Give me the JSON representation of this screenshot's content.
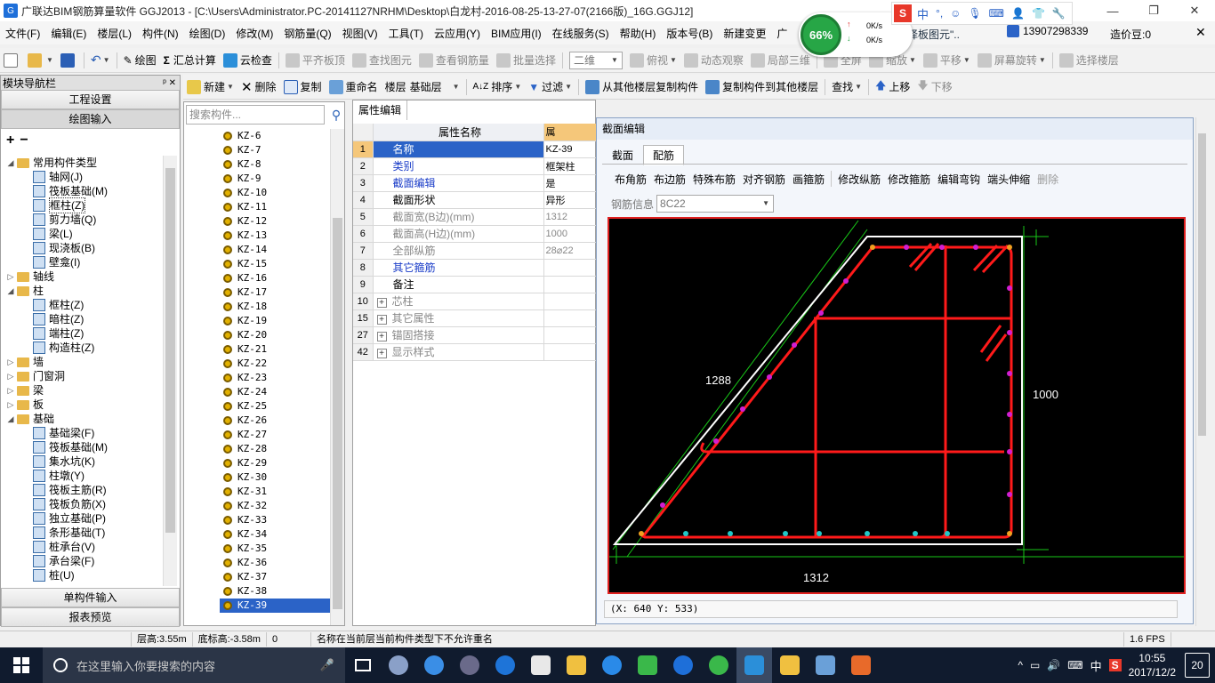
{
  "window": {
    "title": "广联达BIM钢筋算量软件 GGJ2013 - [C:\\Users\\Administrator.PC-20141127NRHM\\Desktop\\白龙村-2016-08-25-13-27-07(2166版)_16G.GGJ12]"
  },
  "menu": [
    "文件(F)",
    "编辑(E)",
    "楼层(L)",
    "构件(N)",
    "绘图(D)",
    "修改(M)",
    "钢筋量(Q)",
    "视图(V)",
    "工具(T)",
    "云应用(Y)",
    "BIM应用(I)",
    "在线服务(S)",
    "帮助(H)",
    "版本号(B)",
    "新建变更",
    "广"
  ],
  "menu_right": {
    "select_hint": "选择板图元\"..",
    "phone": "13907298339",
    "price": "造价豆:0"
  },
  "toolbar1": {
    "draw": "绘图",
    "sum": "汇总计算",
    "cloud_check": "云检查",
    "flat_top": "平齐板顶",
    "find_element": "查找图元",
    "view_rebar": "查看钢筋量",
    "batch_select": "批量选择",
    "view_mode": "二维",
    "top_view": "俯视",
    "dynamic": "动态观察",
    "local_3d": "局部三维",
    "full_screen": "全屏",
    "zoom": "缩放",
    "pan": "平移",
    "rotate": "屏幕旋转",
    "select_floor": "选择楼层"
  },
  "toolbar2": {
    "new": "新建",
    "delete": "删除",
    "copy": "复制",
    "rename": "重命名",
    "floor_label": "楼层",
    "floor_value": "基础层",
    "sort": "排序",
    "filter": "过滤",
    "copy_from": "从其他楼层复制构件",
    "copy_to": "复制构件到其他楼层",
    "find": "查找",
    "up": "上移",
    "down": "下移"
  },
  "leftnav": {
    "header": "模块导航栏",
    "project_settings": "工程设置",
    "drawing_input": "绘图输入",
    "single_input": "单构件输入",
    "report_preview": "报表预览",
    "tree": [
      {
        "level": 0,
        "exp": "−",
        "type": "folder",
        "label": "常用构件类型"
      },
      {
        "level": 1,
        "type": "comp",
        "label": "轴网(J)"
      },
      {
        "level": 1,
        "type": "comp",
        "label": "筏板基础(M)"
      },
      {
        "level": 1,
        "type": "comp",
        "label": "框柱(Z)"
      },
      {
        "level": 1,
        "type": "comp",
        "label": "剪力墙(Q)"
      },
      {
        "level": 1,
        "type": "comp",
        "label": "梁(L)"
      },
      {
        "level": 1,
        "type": "comp",
        "label": "现浇板(B)"
      },
      {
        "level": 1,
        "type": "comp",
        "label": "壁龛(I)"
      },
      {
        "level": 0,
        "exp": "+",
        "type": "folder",
        "label": "轴线"
      },
      {
        "level": 0,
        "exp": "−",
        "type": "folder",
        "label": "柱"
      },
      {
        "level": 1,
        "type": "comp",
        "label": "框柱(Z)"
      },
      {
        "level": 1,
        "type": "comp",
        "label": "暗柱(Z)"
      },
      {
        "level": 1,
        "type": "comp",
        "label": "端柱(Z)"
      },
      {
        "level": 1,
        "type": "comp",
        "label": "构造柱(Z)"
      },
      {
        "level": 0,
        "exp": "+",
        "type": "folder",
        "label": "墙"
      },
      {
        "level": 0,
        "exp": "+",
        "type": "folder",
        "label": "门窗洞"
      },
      {
        "level": 0,
        "exp": "+",
        "type": "folder",
        "label": "梁"
      },
      {
        "level": 0,
        "exp": "+",
        "type": "folder",
        "label": "板"
      },
      {
        "level": 0,
        "exp": "−",
        "type": "folder",
        "label": "基础"
      },
      {
        "level": 1,
        "type": "comp",
        "label": "基础梁(F)"
      },
      {
        "level": 1,
        "type": "comp",
        "label": "筏板基础(M)"
      },
      {
        "level": 1,
        "type": "comp",
        "label": "集水坑(K)"
      },
      {
        "level": 1,
        "type": "comp",
        "label": "柱墩(Y)"
      },
      {
        "level": 1,
        "type": "comp",
        "label": "筏板主筋(R)"
      },
      {
        "level": 1,
        "type": "comp",
        "label": "筏板负筋(X)"
      },
      {
        "level": 1,
        "type": "comp",
        "label": "独立基础(P)"
      },
      {
        "level": 1,
        "type": "comp",
        "label": "条形基础(T)"
      },
      {
        "level": 1,
        "type": "comp",
        "label": "桩承台(V)"
      },
      {
        "level": 1,
        "type": "comp",
        "label": "承台梁(F)"
      },
      {
        "level": 1,
        "type": "comp",
        "label": "桩(U)"
      }
    ]
  },
  "complist": {
    "search_placeholder": "搜索构件...",
    "items": [
      "KZ-6",
      "KZ-7",
      "KZ-8",
      "KZ-9",
      "KZ-10",
      "KZ-11",
      "KZ-12",
      "KZ-13",
      "KZ-14",
      "KZ-15",
      "KZ-16",
      "KZ-17",
      "KZ-18",
      "KZ-19",
      "KZ-20",
      "KZ-21",
      "KZ-22",
      "KZ-23",
      "KZ-24",
      "KZ-25",
      "KZ-26",
      "KZ-27",
      "KZ-28",
      "KZ-29",
      "KZ-30",
      "KZ-31",
      "KZ-32",
      "KZ-33",
      "KZ-34",
      "KZ-35",
      "KZ-36",
      "KZ-37",
      "KZ-38",
      "KZ-39"
    ],
    "selected": "KZ-39"
  },
  "props": {
    "tab": "属性编辑",
    "col_name": "属性名称",
    "col_value": "属",
    "rows": [
      {
        "n": "1",
        "name": "名称",
        "value": "KZ-39",
        "style": "blue",
        "sel": true
      },
      {
        "n": "2",
        "name": "类别",
        "value": "框架柱",
        "style": "blue"
      },
      {
        "n": "3",
        "name": "截面编辑",
        "value": "是",
        "style": "blue"
      },
      {
        "n": "4",
        "name": "截面形状",
        "value": "异形",
        "style": ""
      },
      {
        "n": "5",
        "name": "截面宽(B边)(mm)",
        "value": "1312",
        "style": "gray"
      },
      {
        "n": "6",
        "name": "截面高(H边)(mm)",
        "value": "1000",
        "style": "gray"
      },
      {
        "n": "7",
        "name": "全部纵筋",
        "value": "28⌀22",
        "style": "gray"
      },
      {
        "n": "8",
        "name": "其它箍筋",
        "value": "",
        "style": "blue"
      },
      {
        "n": "9",
        "name": "备注",
        "value": "",
        "style": ""
      },
      {
        "n": "10",
        "name": "芯柱",
        "value": "",
        "style": "gray",
        "plus": true
      },
      {
        "n": "15",
        "name": "其它属性",
        "value": "",
        "style": "gray",
        "plus": true
      },
      {
        "n": "27",
        "name": "锚固搭接",
        "value": "",
        "style": "gray",
        "plus": true
      },
      {
        "n": "42",
        "name": "显示样式",
        "value": "",
        "style": "gray",
        "plus": true
      }
    ]
  },
  "section_editor": {
    "title": "截面编辑",
    "tabs": [
      "截面",
      "配筋"
    ],
    "active_tab": "配筋",
    "tools": [
      "布角筋",
      "布边筋",
      "特殊布筋",
      "对齐钢筋",
      "画箍筋",
      "修改纵筋",
      "修改箍筋",
      "编辑弯钩",
      "端头伸缩",
      "删除"
    ],
    "rebar_info_label": "钢筋信息",
    "rebar_info_value": "8C22",
    "dim_width": "1312",
    "dim_height": "1000",
    "dim_diag": "1288",
    "coord": "(X: 640 Y: 533)"
  },
  "statusbar": {
    "floor_height": "层高:3.55m",
    "bottom_height": "底标高:-3.58m",
    "zero": "0",
    "message": "名称在当前层当前构件类型下不允许重名",
    "fps": "1.6 FPS"
  },
  "taskbar": {
    "search_placeholder": "在这里输入你要搜索的内容",
    "time": "10:55",
    "date": "2017/12/2",
    "ime": "中",
    "notifications": "20"
  },
  "widgets": {
    "net_percent": "66%",
    "net_up": "0K/s",
    "net_down": "0K/s",
    "ime_label": "中"
  },
  "colors": {
    "rebar": "#ff1a1a",
    "outline": "#ffffff",
    "dimension": "#18c818",
    "dot_magenta": "#d21ed2",
    "dot_cyan": "#20c8c8"
  }
}
